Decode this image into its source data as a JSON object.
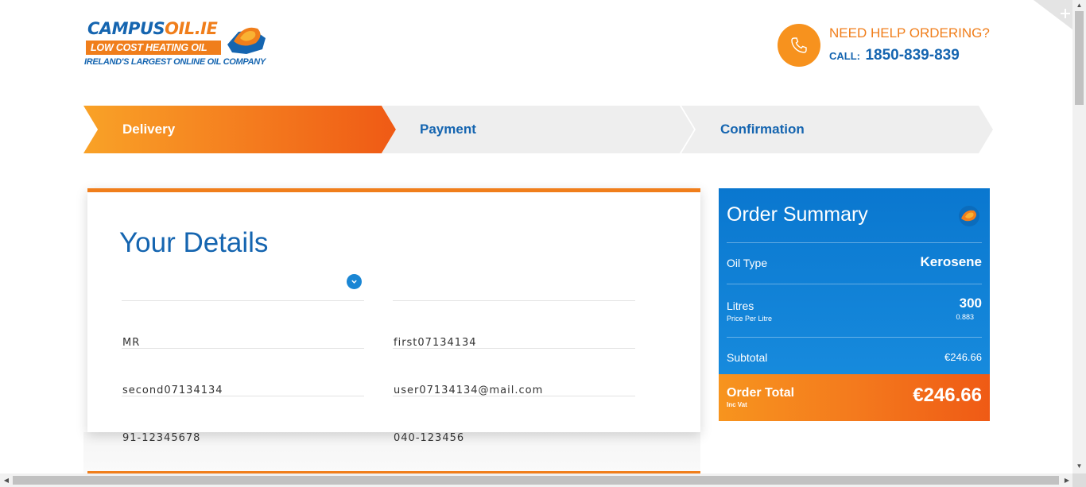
{
  "logo": {
    "main_left": "CAMPUS",
    "main_right": "OIL.IE",
    "band": "LOW COST HEATING OIL",
    "tagline": "IRELAND'S LARGEST ONLINE OIL COMPANY"
  },
  "help": {
    "title": "NEED HELP ORDERING?",
    "call_label": "CALL:",
    "phone": "1850-839-839",
    "icon": "phone-icon"
  },
  "steps": [
    {
      "label": "Delivery",
      "active": true
    },
    {
      "label": "Payment",
      "active": false
    },
    {
      "label": "Confirmation",
      "active": false
    }
  ],
  "details": {
    "title": "Your Details",
    "fields": {
      "title_select": "MR",
      "first_name": "first07134134",
      "second_name": "second07134134",
      "email": "user07134134@mail.com",
      "phone1": "91-12345678",
      "phone2": "040-123456"
    }
  },
  "summary": {
    "title": "Order Summary",
    "oil_type_label": "Oil Type",
    "oil_type": "Kerosene",
    "litres_label": "Litres",
    "litres": "300",
    "price_per_litre_label": "Price Per Litre",
    "price_per_litre": "0.883",
    "subtotal_label": "Subtotal",
    "subtotal": "€246.66",
    "total_label": "Order Total",
    "total_sub": "Inc Vat",
    "total": "€246.66"
  },
  "colors": {
    "brand_blue": "#1565b0",
    "brand_orange": "#f07e1b",
    "summary_blue": "#0a77cf"
  }
}
